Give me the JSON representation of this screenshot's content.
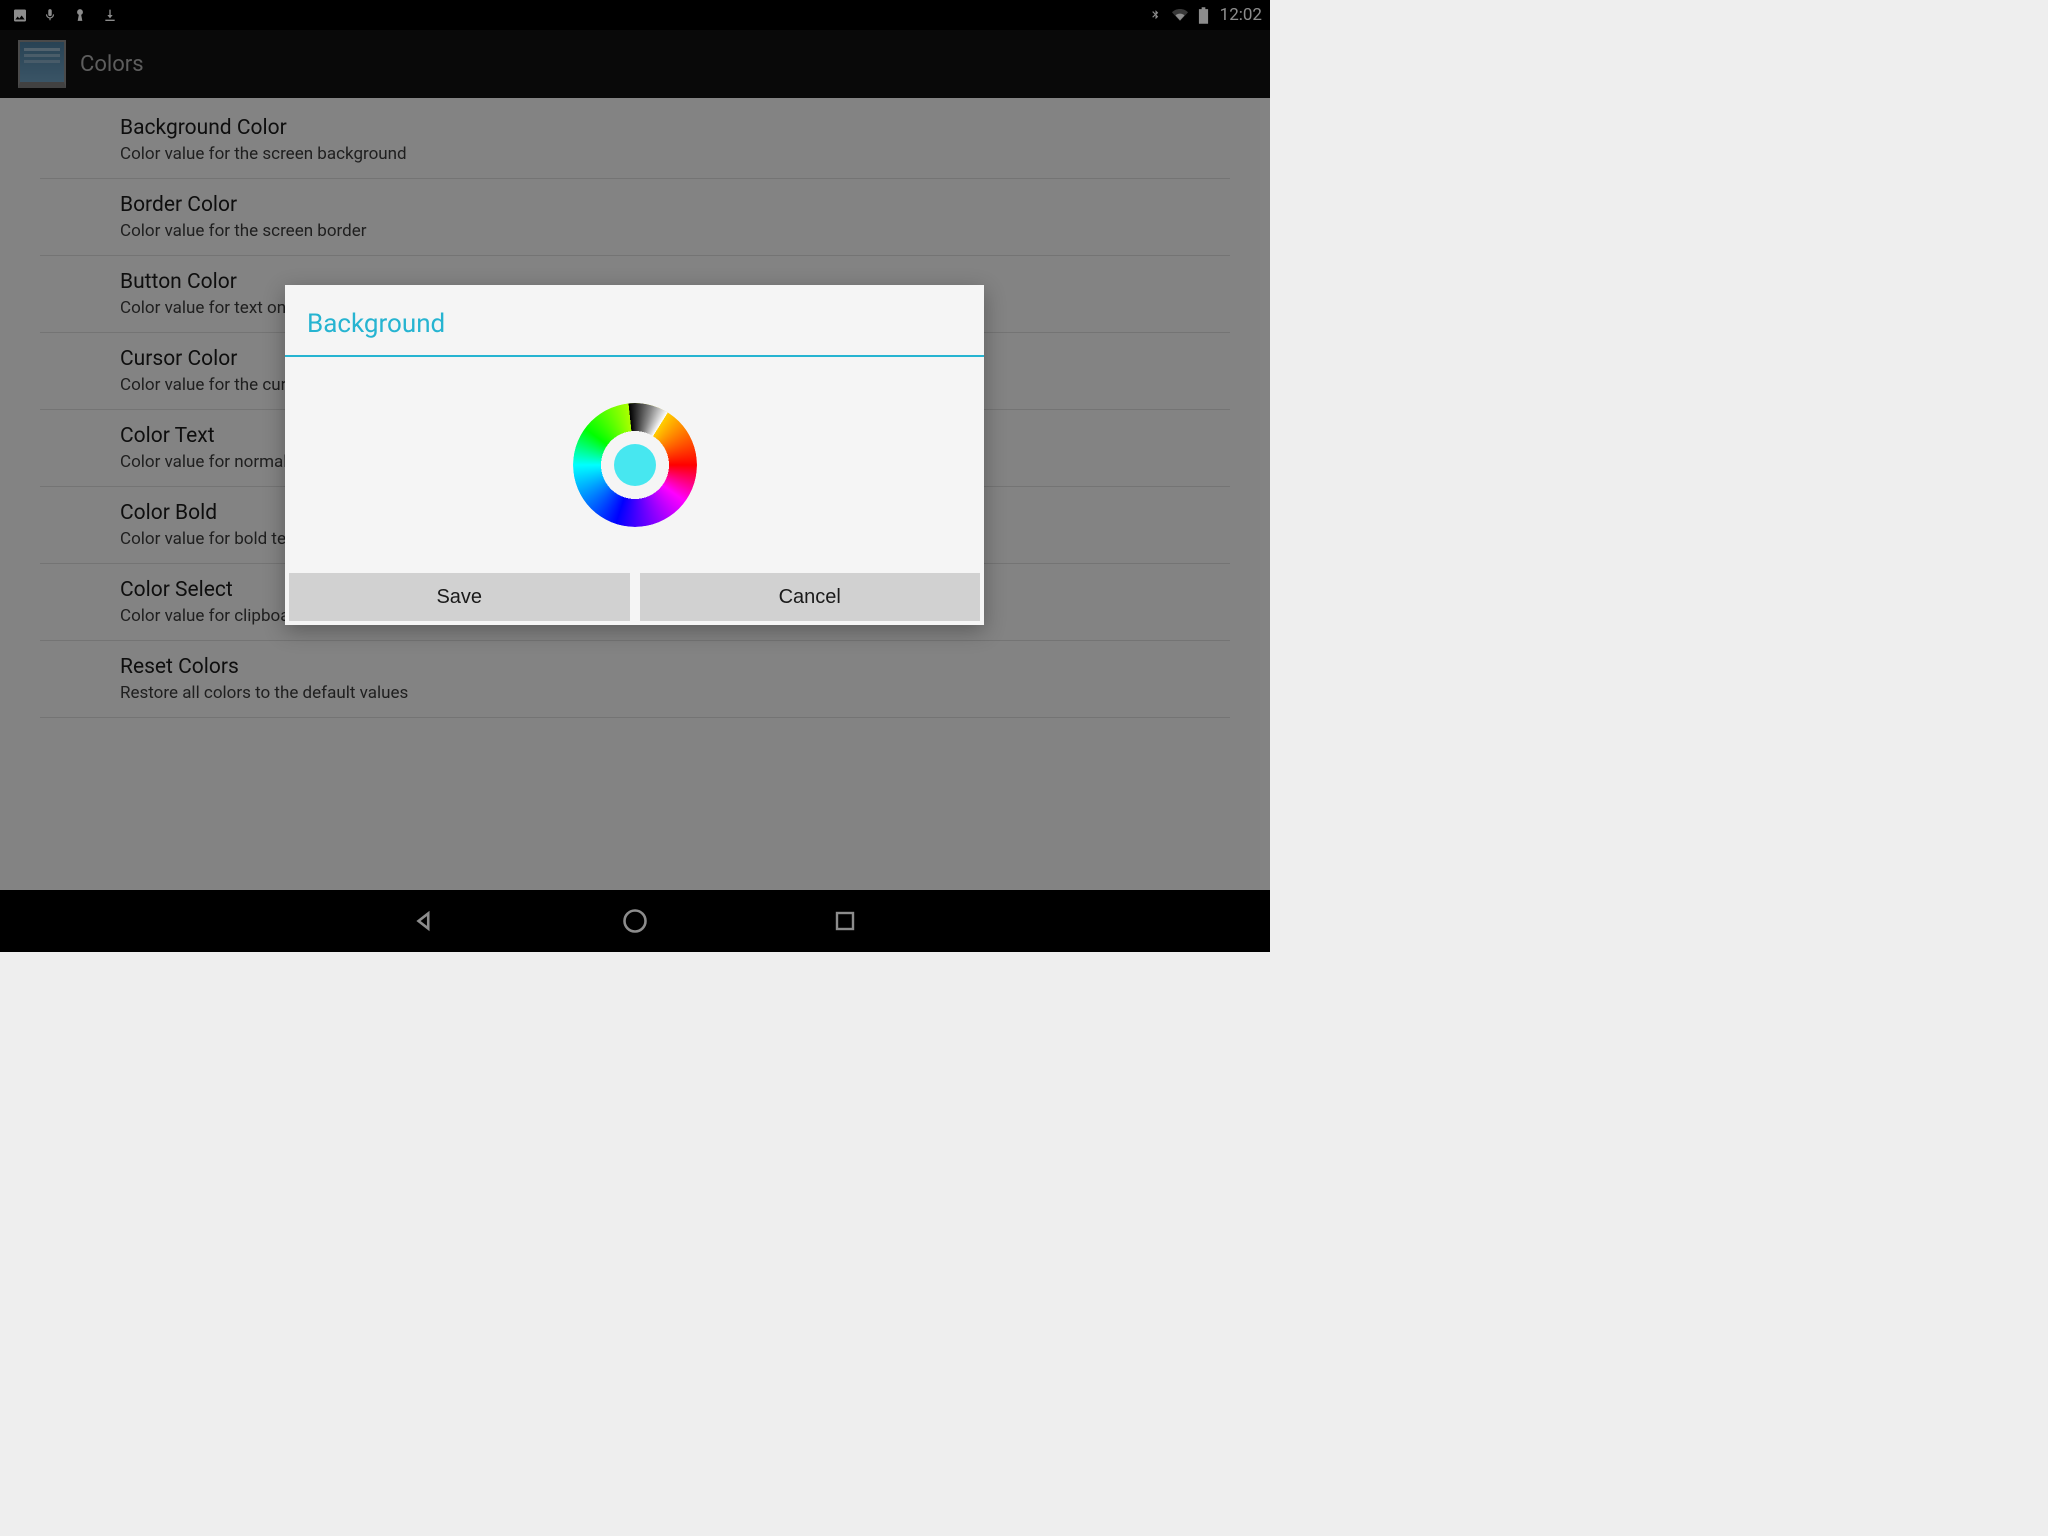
{
  "status": {
    "time": "12:02"
  },
  "app": {
    "title": "Colors"
  },
  "settings": [
    {
      "title": "Background Color",
      "sub": "Color value for the screen background"
    },
    {
      "title": "Border Color",
      "sub": "Color value for the screen border"
    },
    {
      "title": "Button Color",
      "sub": "Color value for text on buttons"
    },
    {
      "title": "Cursor Color",
      "sub": "Color value for the cursor"
    },
    {
      "title": "Color Text",
      "sub": "Color value for normal text"
    },
    {
      "title": "Color Bold",
      "sub": "Color value for bold text"
    },
    {
      "title": "Color Select",
      "sub": "Color value for clipboard select"
    },
    {
      "title": "Reset Colors",
      "sub": "Restore all colors to the default values"
    }
  ],
  "dialog": {
    "title": "Background",
    "selected_color": "#47e7f0",
    "save_label": "Save",
    "cancel_label": "Cancel"
  }
}
